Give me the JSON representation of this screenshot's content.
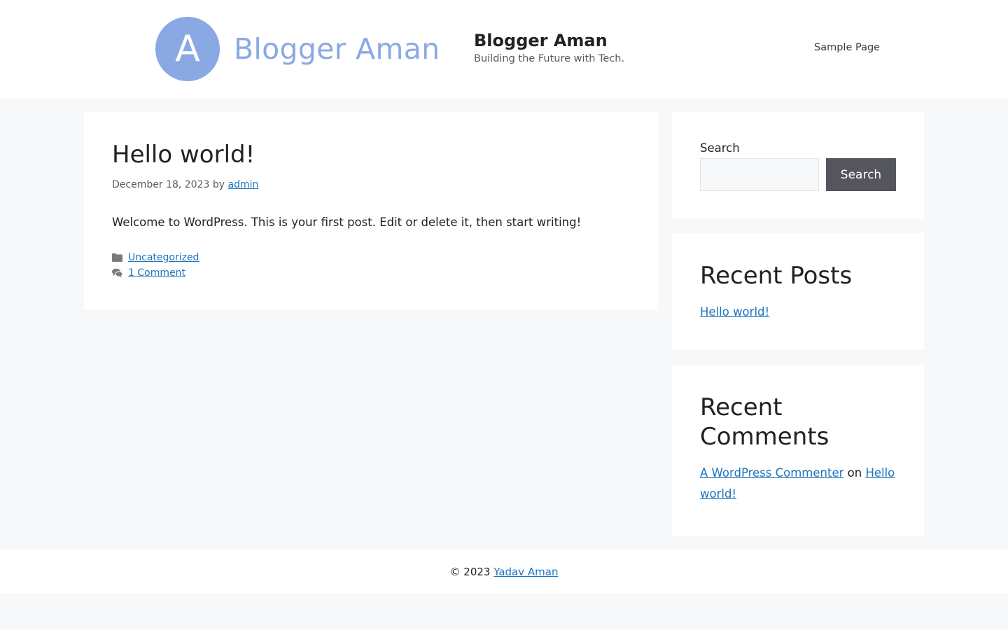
{
  "header": {
    "logo_letter": "A",
    "logo_text": "Blogger Aman",
    "site_title": "Blogger Aman",
    "site_description": "Building the Future with Tech.",
    "nav": [
      "Sample Page"
    ]
  },
  "article": {
    "title": "Hello world!",
    "date": "December 18, 2023",
    "by": "by",
    "author": "admin",
    "content": "Welcome to WordPress. This is your first post. Edit or delete it, then start writing!",
    "category": "Uncategorized",
    "comments": "1 Comment",
    "category_icon": "folder-icon",
    "comments_icon": "comments-icon"
  },
  "sidebar": {
    "search_label": "Search",
    "search_button": "Search",
    "search_value": "",
    "recent_posts_title": "Recent Posts",
    "recent_posts": [
      "Hello world!"
    ],
    "recent_comments_title": "Recent Comments",
    "recent_comment": {
      "author": "A WordPress Commenter",
      "on": "on",
      "post": "Hello world!"
    }
  },
  "footer": {
    "copyright": "© 2023",
    "owner": "Yadav Aman"
  },
  "colors": {
    "accent": "#1e73be",
    "logo": "#8aa9e4",
    "button": "#55555e",
    "background": "#f7f8f9"
  }
}
